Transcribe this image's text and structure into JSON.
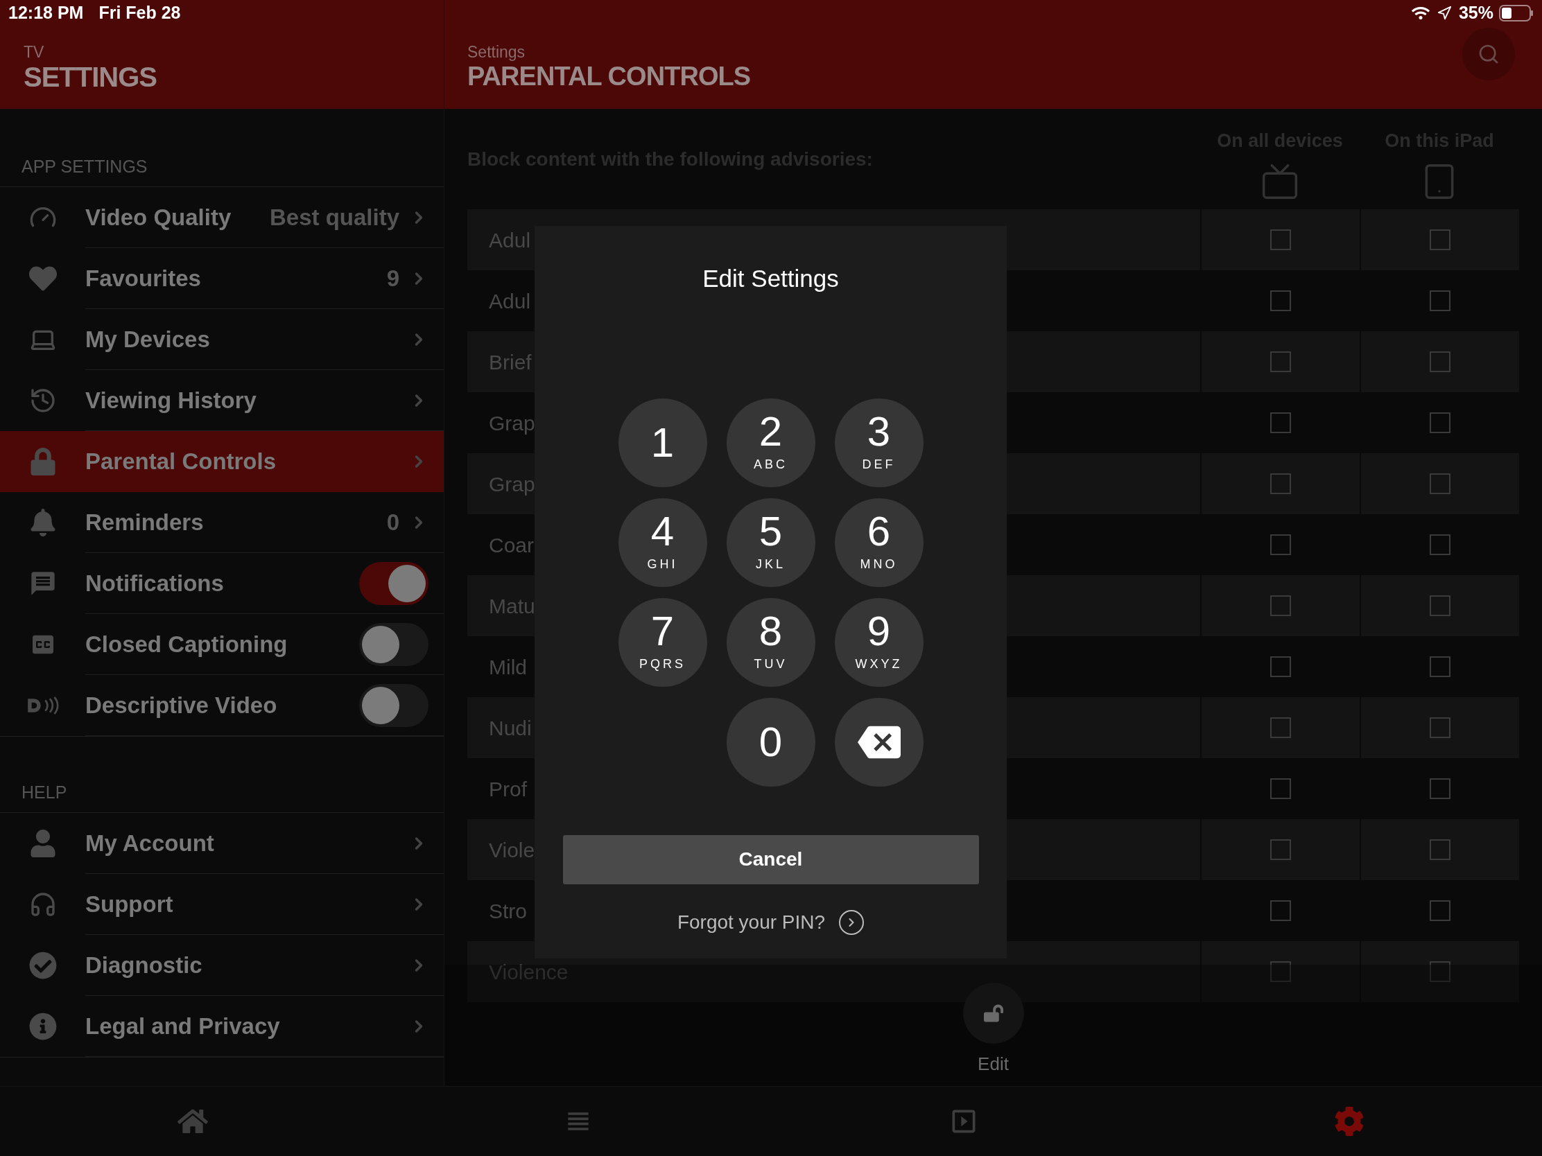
{
  "status_bar": {
    "time": "12:18 PM",
    "date": "Fri Feb 28",
    "battery": "35%"
  },
  "sidebar": {
    "header": {
      "subtitle": "TV",
      "title": "SETTINGS"
    },
    "sections": [
      {
        "title": "APP SETTINGS",
        "items": [
          {
            "label": "Video Quality",
            "kind": "link",
            "value": "Best quality",
            "selected": false
          },
          {
            "label": "Favourites",
            "kind": "link",
            "value": "9",
            "selected": false
          },
          {
            "label": "My Devices",
            "kind": "link",
            "selected": false
          },
          {
            "label": "Viewing History",
            "kind": "link",
            "selected": false
          },
          {
            "label": "Parental Controls",
            "kind": "link",
            "selected": true
          },
          {
            "label": "Reminders",
            "kind": "link",
            "value": "0",
            "selected": false
          },
          {
            "label": "Notifications",
            "kind": "toggle",
            "on": true,
            "selected": false
          },
          {
            "label": "Closed Captioning",
            "kind": "toggle",
            "on": false,
            "selected": false
          },
          {
            "label": "Descriptive Video",
            "kind": "toggle",
            "on": false,
            "selected": false
          }
        ]
      },
      {
        "title": "HELP",
        "items": [
          {
            "label": "My Account",
            "kind": "link",
            "selected": false
          },
          {
            "label": "Support",
            "kind": "link",
            "selected": false
          },
          {
            "label": "Diagnostic",
            "kind": "link",
            "selected": false
          },
          {
            "label": "Legal and Privacy",
            "kind": "link",
            "selected": false
          }
        ]
      }
    ]
  },
  "main": {
    "header": {
      "subtitle": "Settings",
      "title": "PARENTAL CONTROLS"
    },
    "table": {
      "heading": "Block content with the following advisories:",
      "columns": [
        "On all devices",
        "On this iPad"
      ],
      "rows": [
        {
          "label": "Adul",
          "all_devices": false,
          "this_ipad": false
        },
        {
          "label": "Adul",
          "all_devices": false,
          "this_ipad": false
        },
        {
          "label": "Brief",
          "all_devices": false,
          "this_ipad": false
        },
        {
          "label": "Grap",
          "all_devices": false,
          "this_ipad": false
        },
        {
          "label": "Grap",
          "all_devices": false,
          "this_ipad": false
        },
        {
          "label": "Coar",
          "all_devices": false,
          "this_ipad": false
        },
        {
          "label": "Matu",
          "all_devices": false,
          "this_ipad": false
        },
        {
          "label": "Mild",
          "all_devices": false,
          "this_ipad": false
        },
        {
          "label": "Nudi",
          "all_devices": false,
          "this_ipad": false
        },
        {
          "label": "Prof",
          "all_devices": false,
          "this_ipad": false
        },
        {
          "label": "Viole",
          "all_devices": false,
          "this_ipad": false
        },
        {
          "label": "Stro",
          "all_devices": false,
          "this_ipad": false
        },
        {
          "label": "Violence",
          "all_devices": false,
          "this_ipad": false
        }
      ]
    },
    "edit_button": "Edit"
  },
  "dialog": {
    "title": "Edit Settings",
    "keys": [
      {
        "kind": "digit",
        "digit": "1"
      },
      {
        "kind": "digit",
        "digit": "2",
        "letters": "ABC"
      },
      {
        "kind": "digit",
        "digit": "3",
        "letters": "DEF"
      },
      {
        "kind": "digit",
        "digit": "4",
        "letters": "GHI"
      },
      {
        "kind": "digit",
        "digit": "5",
        "letters": "JKL"
      },
      {
        "kind": "digit",
        "digit": "6",
        "letters": "MNO"
      },
      {
        "kind": "digit",
        "digit": "7",
        "letters": "PQRS"
      },
      {
        "kind": "digit",
        "digit": "8",
        "letters": "TUV"
      },
      {
        "kind": "digit",
        "digit": "9",
        "letters": "WXYZ"
      },
      {
        "kind": "spacer"
      },
      {
        "kind": "digit",
        "digit": "0"
      },
      {
        "kind": "delete"
      }
    ],
    "cancel": "Cancel",
    "forgot": "Forgot your PIN?"
  },
  "tab_bar": [
    {
      "selected": false
    },
    {
      "selected": false
    },
    {
      "selected": false
    },
    {
      "selected": true
    }
  ]
}
